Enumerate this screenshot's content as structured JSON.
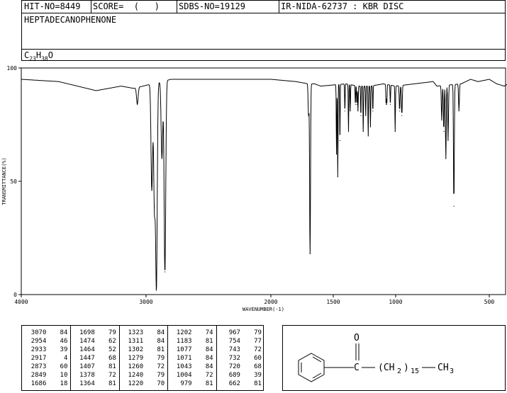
{
  "header": {
    "hit_no": "HIT-NO=8449",
    "score": "SCORE=  (   )",
    "sdbs_no": "SDBS-NO=19129",
    "ir_nida": "IR-NIDA-62737 : KBR DISC",
    "compound_name": "HEPTADECANOPHENONE",
    "formula_c": "C",
    "formula_c_sub": "23",
    "formula_h": "H",
    "formula_h_sub": "38",
    "formula_o": "O"
  },
  "structure": {
    "o_label": "O",
    "c_label": "C",
    "chain_open": "(CH",
    "chain_sub2": "2",
    "chain_close": ")",
    "chain_sub15": "15",
    "tail": "CH",
    "tail_sub": "3"
  },
  "peaks": [
    [
      [
        3070,
        84
      ],
      [
        2954,
        46
      ],
      [
        2933,
        39
      ],
      [
        2917,
        4
      ],
      [
        2873,
        60
      ],
      [
        2849,
        10
      ],
      [
        1686,
        18
      ]
    ],
    [
      [
        1698,
        79
      ],
      [
        1474,
        62
      ],
      [
        1464,
        52
      ],
      [
        1447,
        68
      ],
      [
        1407,
        81
      ],
      [
        1378,
        72
      ],
      [
        1364,
        81
      ]
    ],
    [
      [
        1323,
        84
      ],
      [
        1311,
        84
      ],
      [
        1302,
        81
      ],
      [
        1279,
        79
      ],
      [
        1260,
        72
      ],
      [
        1240,
        79
      ],
      [
        1220,
        70
      ]
    ],
    [
      [
        1202,
        74
      ],
      [
        1183,
        81
      ],
      [
        1077,
        84
      ],
      [
        1071,
        84
      ],
      [
        1043,
        84
      ],
      [
        1004,
        72
      ],
      [
        979,
        81
      ]
    ],
    [
      [
        967,
        79
      ],
      [
        754,
        77
      ],
      [
        743,
        72
      ],
      [
        732,
        60
      ],
      [
        720,
        68
      ],
      [
        689,
        39
      ],
      [
        662,
        81
      ]
    ]
  ],
  "chart_data": {
    "type": "line",
    "title": "",
    "xlabel": "WAVENUMBER(-1)",
    "ylabel": "TRANSMITTANCE(%)",
    "xlim": [
      4000,
      400
    ],
    "ylim": [
      0,
      100
    ],
    "x_ticks": [
      4000,
      3000,
      2000,
      1500,
      1000,
      500
    ],
    "y_ticks": [
      0,
      50,
      100
    ],
    "grid": false,
    "series": [
      {
        "baseline": [
          [
            4000,
            95
          ],
          [
            3700,
            94
          ],
          [
            3400,
            90
          ],
          [
            3200,
            92
          ],
          [
            3100,
            91
          ],
          [
            2800,
            95
          ],
          [
            2000,
            95
          ],
          [
            1800,
            94
          ],
          [
            1700,
            93
          ],
          [
            1650,
            93
          ],
          [
            1600,
            92
          ],
          [
            1400,
            93
          ],
          [
            1300,
            92
          ],
          [
            1200,
            92
          ],
          [
            1100,
            93
          ],
          [
            1000,
            92
          ],
          [
            900,
            93
          ],
          [
            800,
            94
          ],
          [
            780,
            92
          ],
          [
            650,
            93
          ],
          [
            600,
            95
          ],
          [
            560,
            94
          ],
          [
            500,
            95
          ],
          [
            460,
            93
          ],
          [
            420,
            92
          ],
          [
            400,
            93
          ]
        ],
        "peaks": [
          [
            3070,
            84
          ],
          [
            2954,
            46
          ],
          [
            2933,
            39
          ],
          [
            2917,
            4
          ],
          [
            2873,
            60
          ],
          [
            2849,
            10
          ],
          [
            1698,
            79
          ],
          [
            1686,
            18
          ],
          [
            1474,
            62
          ],
          [
            1464,
            52
          ],
          [
            1447,
            68
          ],
          [
            1407,
            81
          ],
          [
            1378,
            72
          ],
          [
            1364,
            81
          ],
          [
            1323,
            84
          ],
          [
            1311,
            84
          ],
          [
            1302,
            81
          ],
          [
            1279,
            79
          ],
          [
            1260,
            72
          ],
          [
            1240,
            79
          ],
          [
            1220,
            70
          ],
          [
            1202,
            74
          ],
          [
            1183,
            81
          ],
          [
            1077,
            84
          ],
          [
            1071,
            84
          ],
          [
            1043,
            84
          ],
          [
            1004,
            72
          ],
          [
            979,
            81
          ],
          [
            967,
            79
          ],
          [
            754,
            77
          ],
          [
            743,
            72
          ],
          [
            732,
            60
          ],
          [
            720,
            68
          ],
          [
            689,
            39
          ],
          [
            662,
            81
          ]
        ]
      }
    ]
  }
}
